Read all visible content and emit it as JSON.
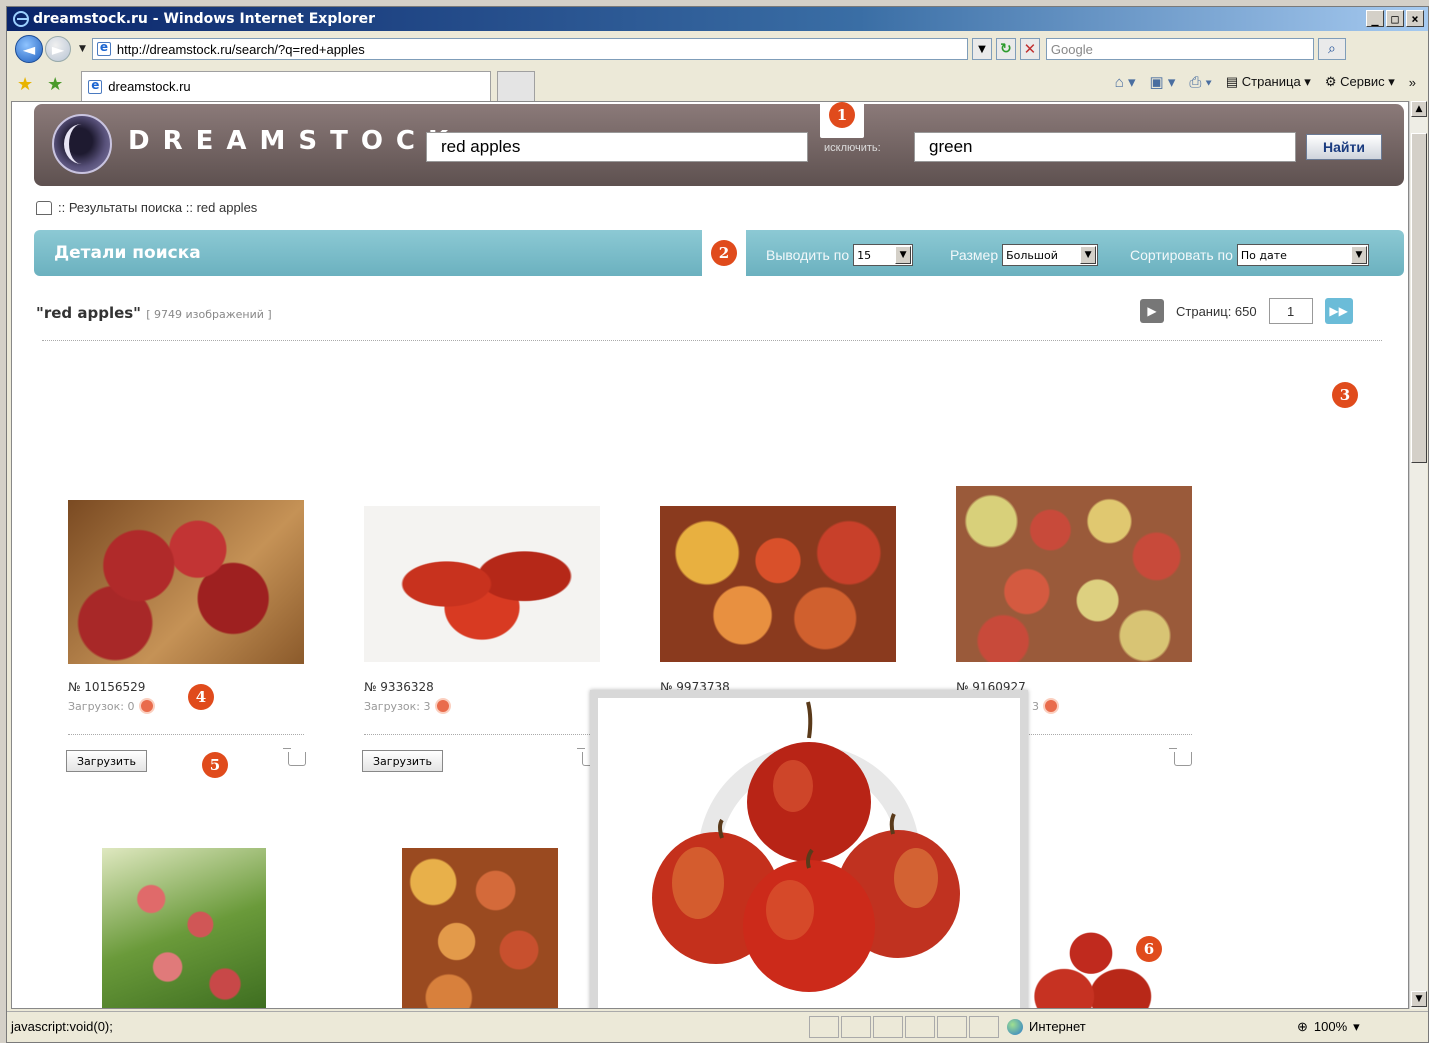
{
  "browser": {
    "title": "dreamstock.ru - Windows Internet Explorer",
    "url": "http://dreamstock.ru/search/?q=red+apples",
    "search_placeholder": "Google",
    "tab_title": "dreamstock.ru",
    "cmd_page": "Страница",
    "cmd_tools": "Сервис",
    "status_text": "javascript:void(0);",
    "zone": "Интернет",
    "zoom": "100%"
  },
  "site": {
    "logo": "DREAMSTOCK",
    "query": "red apples",
    "exclude_label": "исключить:",
    "exclude_value": "green",
    "find_label": "Найти",
    "breadcrumb": ":: Результаты поиска :: red apples",
    "details_title": "Детали поиска",
    "per_page_label": "Выводить по",
    "per_page_value": "15",
    "size_label": "Размер",
    "size_value": "Большой",
    "sort_label": "Сортировать по",
    "sort_value": "По дате",
    "results_query": "\"red apples\"",
    "results_count": "[ 9749 изображений ]",
    "pages_label": "Страниц: 650",
    "page_value": "1"
  },
  "items": [
    {
      "id": "№ 10156529",
      "downloads": "Загрузок: 0",
      "button": "Загрузить"
    },
    {
      "id": "№ 9336328",
      "downloads": "Загрузок: 3",
      "button": "Загрузить"
    },
    {
      "id": "№ 9973738",
      "downloads": "",
      "button": ""
    },
    {
      "id": "№ 9160927",
      "downloads": "3",
      "button": ""
    }
  ],
  "markers": [
    "1",
    "2",
    "3",
    "4",
    "5",
    "6"
  ],
  "colors": {
    "header": "#6e6060",
    "details_bar": "#7bbcc8",
    "marker": "#e04b1c",
    "accent_next": "#6bbcd8"
  }
}
